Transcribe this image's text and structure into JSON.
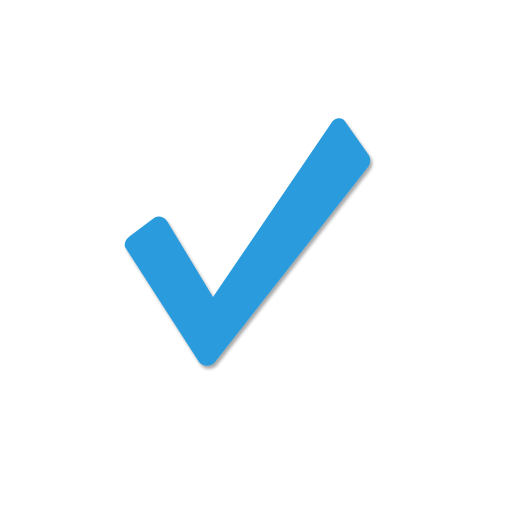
{
  "icon": {
    "name": "checkmark-icon",
    "color": "#2b9bdc",
    "shadow_color": "#1f6f9e",
    "background": "#ffffff"
  }
}
